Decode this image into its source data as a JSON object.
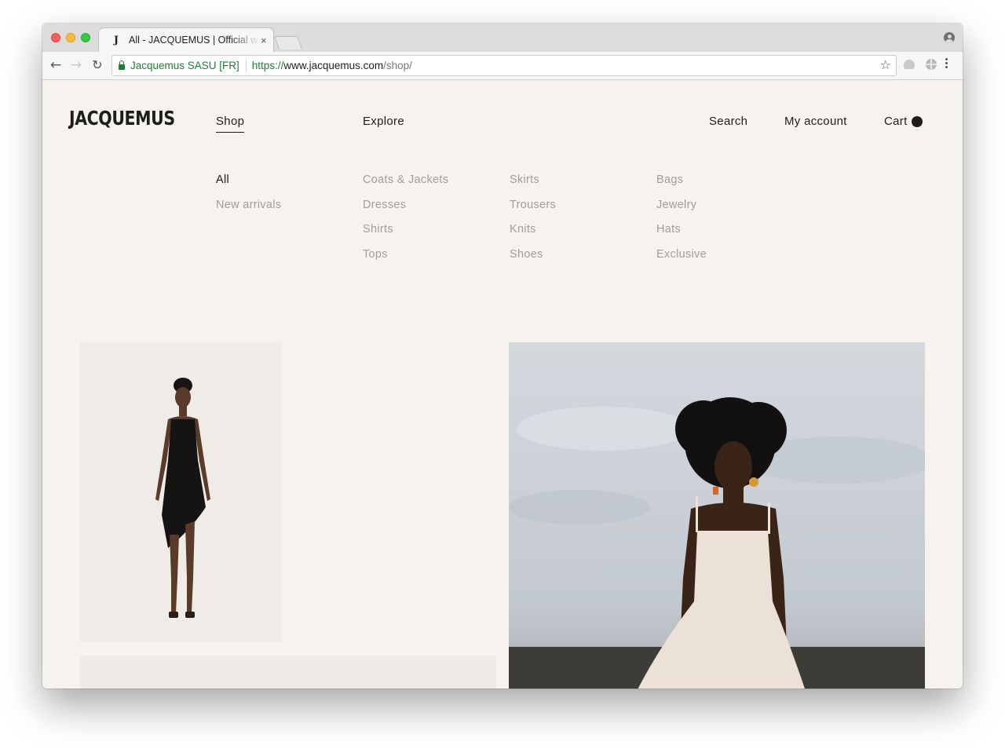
{
  "browser": {
    "tab": {
      "favicon": "J",
      "title": "All - JACQUEMUS | Official website",
      "close": "×"
    },
    "nav": {
      "back": "←",
      "forward": "→",
      "reload": "↻"
    },
    "omnibox": {
      "secure_label": "Jacquemus SASU [FR]",
      "url_scheme": "https://",
      "url_host": "www.jacquemus.com",
      "url_path": "/shop/",
      "star": "☆"
    }
  },
  "site": {
    "logo": "JACQUEMUS",
    "nav": {
      "shop": "Shop",
      "explore": "Explore",
      "search": "Search",
      "account": "My account",
      "cart": "Cart"
    },
    "menu": {
      "columns": [
        [
          "All",
          "New arrivals"
        ],
        [
          "Coats & Jackets",
          "Dresses",
          "Shirts",
          "Tops"
        ],
        [
          "Skirts",
          "Trousers",
          "Knits",
          "Shoes"
        ],
        [
          "Bags",
          "Jewelry",
          "Hats",
          "Exclusive"
        ]
      ],
      "active": "All"
    }
  },
  "colors": {
    "page_bg": "#f6f3ee",
    "text_primary": "#1d1d1b",
    "text_muted": "#a19e99",
    "secure_green": "#1e7e34"
  }
}
